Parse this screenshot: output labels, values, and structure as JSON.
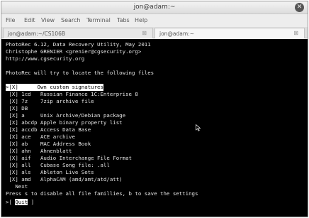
{
  "window": {
    "title": "jon@adam:~",
    "close_glyph": "✕"
  },
  "menubar": {
    "items": [
      "File",
      "Edit",
      "View",
      "Search",
      "Terminal",
      "Tabs",
      "Help"
    ]
  },
  "tabs": [
    {
      "label": "jon@adam:~/CS106B",
      "close": "⊠",
      "active": false
    },
    {
      "label": "jon@adam:~",
      "close": "⊠",
      "active": true
    }
  ],
  "terminal": {
    "header": [
      "PhotoRec 6.12, Data Recovery Utility, May 2011",
      "Christophe GRENIER <grenier@cgsecurity.org>",
      "http://www.cgsecurity.org",
      "",
      "PhotoRec will try to locate the following files"
    ],
    "selected_row": ">[X]      Own custom signatures",
    "rows": [
      " [X] 1cd   Russian Finance 1C:Enterprise 8",
      " [X] 7z    7zip archive file",
      " [X] DB",
      " [X] a     Unix Archive/Debian package",
      " [X] abcdp Apple binary property list",
      " [X] accdb Access Data Base",
      " [X] ace   ACE archive",
      " [X] ab    MAC Address Book",
      " [X] ahn   Ahnenblatt",
      " [X] aif   Audio Interchange File Format",
      " [X] all   Cubase Song file: .all",
      " [X] als   Ableton Live Sets",
      " [X] amd   AlphaCAM (amd/amt/atd/att)"
    ],
    "next": "   Next",
    "help": "Press s to disable all file famillies, b to save the settings",
    "quit_prefix": ">[ ",
    "quit_label": "Quit",
    "quit_suffix": " ]"
  },
  "icons": {
    "mouse_cursor": "mouse-pointer"
  }
}
